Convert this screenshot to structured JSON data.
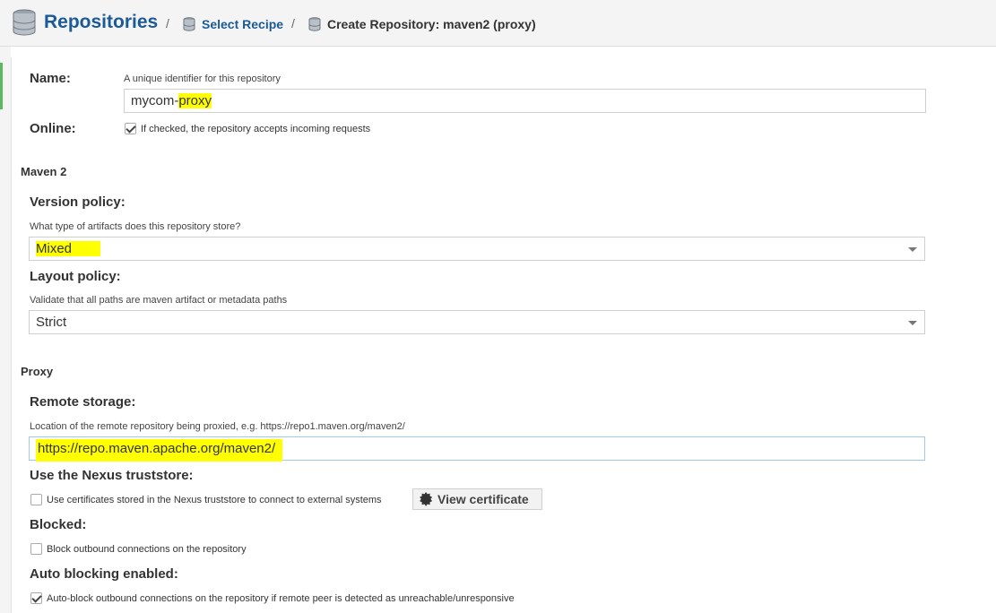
{
  "header": {
    "title": "Repositories",
    "separator": "/",
    "crumb_link": "Select Recipe",
    "crumb_current": "Create Repository: maven2 (proxy)"
  },
  "form": {
    "name": {
      "label": "Name:",
      "help": "A unique identifier for this repository",
      "value_prefix": "mycom-",
      "value_highlight": "proxy"
    },
    "online": {
      "label": "Online:",
      "checked": true,
      "text": "If checked, the repository accepts incoming requests"
    },
    "maven_section": "Maven 2",
    "version_policy": {
      "label": "Version policy:",
      "help": "What type of artifacts does this repository store?",
      "value": "Mixed"
    },
    "layout_policy": {
      "label": "Layout policy:",
      "help": "Validate that all paths are maven artifact or metadata paths",
      "value": "Strict"
    },
    "proxy_section": "Proxy",
    "remote_storage": {
      "label": "Remote storage:",
      "help": "Location of the remote repository being proxied, e.g. https://repo1.maven.org/maven2/",
      "value": "https://repo.maven.apache.org/maven2/"
    },
    "truststore": {
      "label": "Use the Nexus truststore:",
      "checked": false,
      "text": "Use certificates stored in the Nexus truststore to connect to external systems",
      "button": "View certificate"
    },
    "blocked": {
      "label": "Blocked:",
      "checked": false,
      "text": "Block outbound connections on the repository"
    },
    "auto_blocking": {
      "label": "Auto blocking enabled:",
      "checked": true,
      "text": "Auto-block outbound connections on the repository if remote peer is detected as unreachable/unresponsive"
    }
  },
  "colors": {
    "brand_blue": "#1a5a96",
    "highlight": "#ffff00",
    "accent_green": "#5cb85c"
  }
}
